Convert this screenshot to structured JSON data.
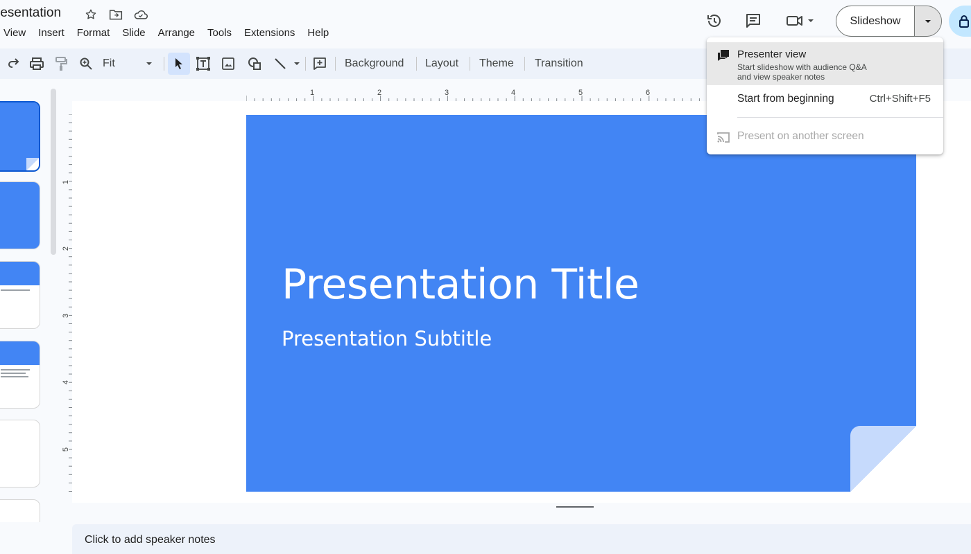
{
  "app": {
    "doc_title": "resentation",
    "menu": [
      "View",
      "Insert",
      "Format",
      "Slide",
      "Arrange",
      "Tools",
      "Extensions",
      "Help"
    ]
  },
  "header": {
    "slideshow_label": "Slideshow"
  },
  "toolbar": {
    "zoom_value": "Fit",
    "background_label": "Background",
    "layout_label": "Layout",
    "theme_label": "Theme",
    "transition_label": "Transition"
  },
  "ruler": {
    "horizontal": [
      "1",
      "2",
      "3",
      "4",
      "5",
      "6"
    ],
    "vertical": [
      "1",
      "2",
      "3",
      "4",
      "5"
    ]
  },
  "slide": {
    "title": "Presentation Title",
    "subtitle": "Presentation Subtitle",
    "background_color": "#4285f4"
  },
  "notes": {
    "placeholder": "Click to add speaker notes"
  },
  "dropdown": {
    "presenter_view": {
      "title": "Presenter view",
      "desc_line1": "Start slideshow with audience Q&A",
      "desc_line2": "and view speaker notes"
    },
    "start_from_beginning": {
      "label": "Start from beginning",
      "shortcut": "Ctrl+Shift+F5"
    },
    "present_another_screen": {
      "label": "Present on another screen"
    }
  },
  "colors": {
    "accent": "#0b57d0",
    "share": "#c2e7ff",
    "toolbar_bg": "#edf2fa"
  }
}
